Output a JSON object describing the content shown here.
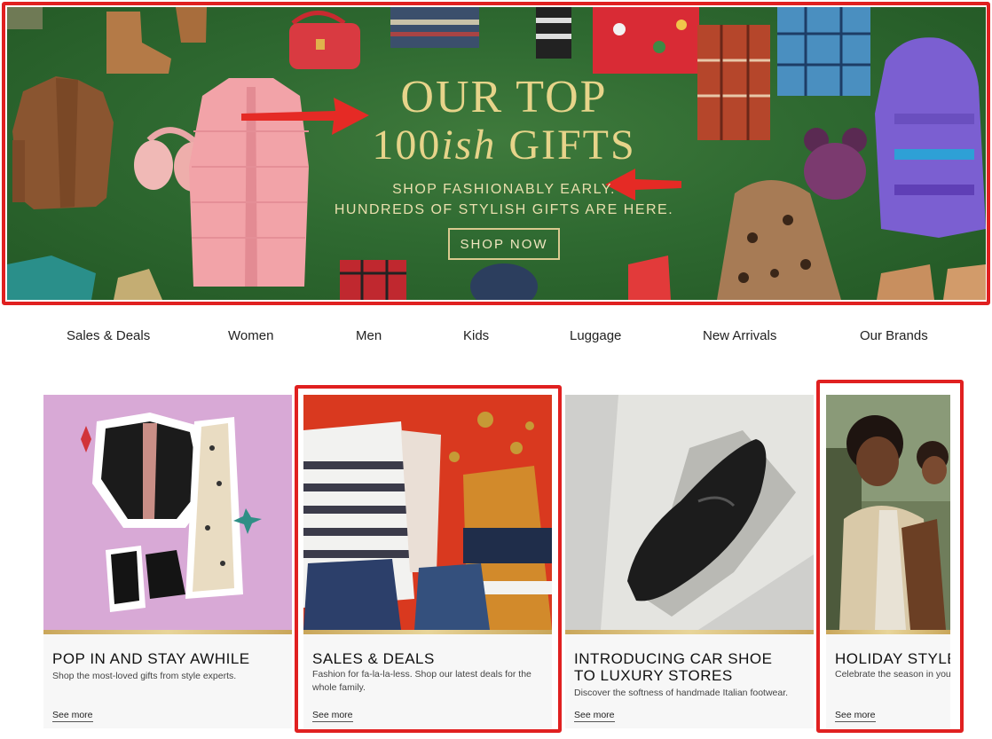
{
  "hero": {
    "headline_line1": "OUR TOP",
    "headline_num": "100",
    "headline_ish": "ish",
    "headline_gifts": " GIFTS",
    "subline1": "SHOP FASHIONABLY EARLY.",
    "subline2": "HUNDREDS OF STYLISH GIFTS ARE HERE.",
    "cta_label": "SHOP NOW",
    "accent_color": "#e7d48a",
    "background_color": "#2f6a31"
  },
  "nav": {
    "items": [
      "Sales & Deals",
      "Women",
      "Men",
      "Kids",
      "Luggage",
      "New Arrivals",
      "Our Brands"
    ]
  },
  "cards": [
    {
      "title": "POP IN AND STAY AWHILE",
      "desc": "Shop the most-loved gifts from style experts.",
      "link": "See more"
    },
    {
      "title": "SALES & DEALS",
      "desc": "Fashion for fa-la-la-less. Shop our latest deals for the whole family.",
      "link": "See more"
    },
    {
      "title": "INTRODUCING CAR SHOE\nTO LUXURY STORES",
      "desc": "Discover the softness of handmade Italian footwear.",
      "link": "See more"
    },
    {
      "title": "HOLIDAY STYLE",
      "desc": "Celebrate the season in your",
      "link": "See more"
    }
  ],
  "highlight_color": "#e02020"
}
